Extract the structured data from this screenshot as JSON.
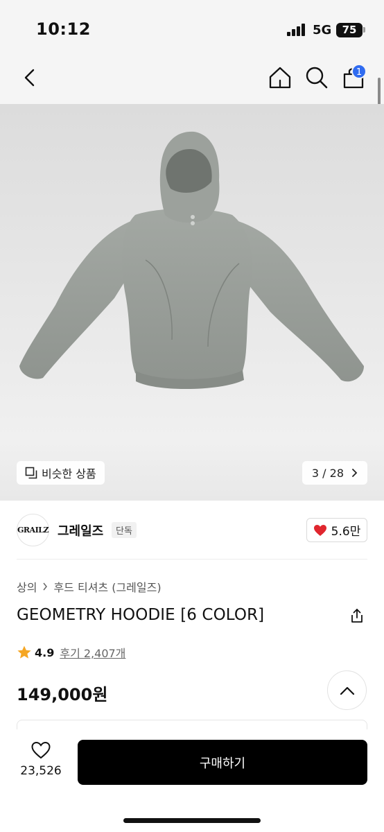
{
  "status_bar": {
    "time": "10:12",
    "network": "5G",
    "battery": "75"
  },
  "nav": {
    "back_icon": "chevron-left-icon",
    "home_icon": "home-icon",
    "search_icon": "search-icon",
    "cart_icon": "shopping-bag-icon",
    "cart_badge": "1"
  },
  "gallery": {
    "similar_label": "비슷한 상품",
    "counter": "3 / 28"
  },
  "brand": {
    "logo_text": "GRAILZ",
    "name": "그레일즈",
    "tag": "단독",
    "likes": "5.6만"
  },
  "product": {
    "breadcrumb": [
      "상의",
      "후드 티셔츠 (그레일즈)"
    ],
    "title": "GEOMETRY HOODIE [6 COLOR]",
    "rating": "4.9",
    "reviews": "후기 2,407개",
    "price": "149,000원"
  },
  "bottom_bar": {
    "wish_count": "23,526",
    "buy_label": "구매하기"
  },
  "colors": {
    "badge": "#2f6bf0",
    "heart": "#e0262e",
    "star": "#f5a623",
    "buy_button": "#000000"
  }
}
